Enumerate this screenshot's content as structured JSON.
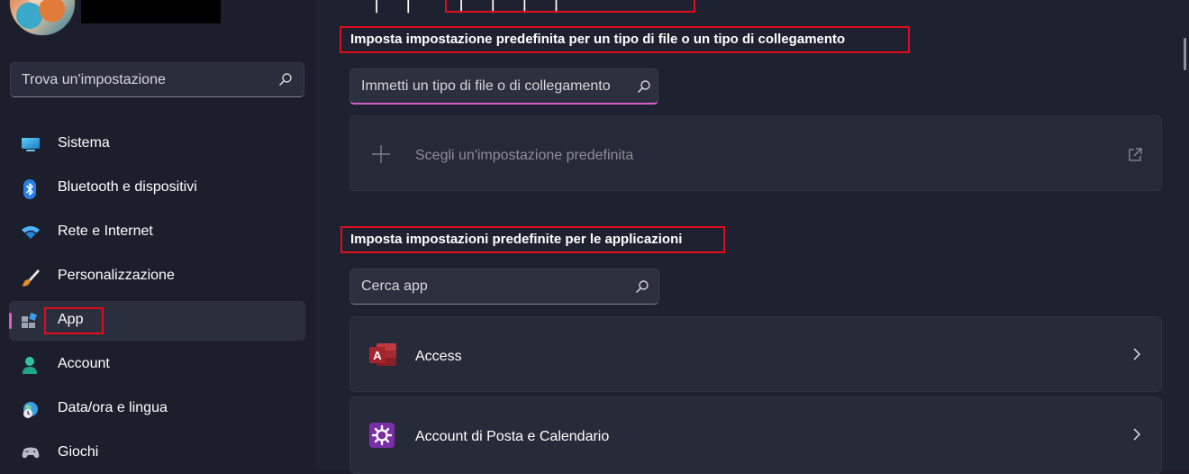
{
  "sidebar": {
    "search_placeholder": "Trova un'impostazione",
    "items": [
      {
        "label": "Sistema",
        "icon": "monitor-icon"
      },
      {
        "label": "Bluetooth e dispositivi",
        "icon": "bluetooth-icon"
      },
      {
        "label": "Rete e Internet",
        "icon": "wifi-icon"
      },
      {
        "label": "Personalizzazione",
        "icon": "paintbrush-icon"
      },
      {
        "label": "App",
        "icon": "apps-icon",
        "selected": true
      },
      {
        "label": "Account",
        "icon": "person-icon"
      },
      {
        "label": "Data/ora e lingua",
        "icon": "globe-clock-icon"
      },
      {
        "label": "Giochi",
        "icon": "gamepad-icon"
      }
    ]
  },
  "main": {
    "file_type_section": {
      "title": "Imposta impostazione predefinita per un tipo di file o un tipo di collegamento",
      "input_placeholder": "Immetti un tipo di file o di collegamento",
      "choose_default_label": "Scegli un'impostazione predefinita"
    },
    "apps_section": {
      "title": "Imposta impostazioni predefinite per le applicazioni",
      "search_placeholder": "Cerca app",
      "apps": [
        {
          "name": "Access",
          "icon": "access-app-icon"
        },
        {
          "name": "Account di Posta e Calendario",
          "icon": "mail-calendar-settings-icon"
        }
      ]
    }
  },
  "colors": {
    "accent": "#d260c8",
    "highlight_box": "#e00b1c",
    "background": "#1c1f2b"
  }
}
